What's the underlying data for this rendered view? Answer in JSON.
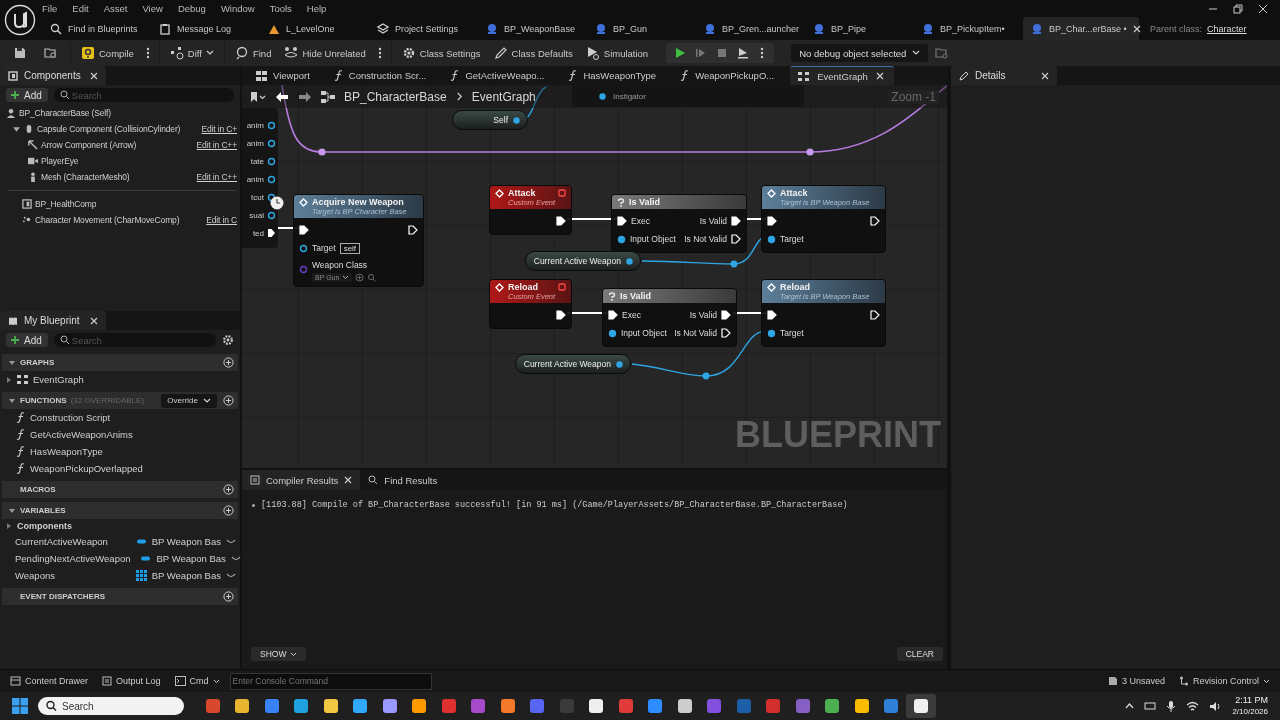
{
  "menu": [
    "File",
    "Edit",
    "Asset",
    "View",
    "Debug",
    "Window",
    "Tools",
    "Help"
  ],
  "asset_tabs": [
    {
      "label": "Find in Blueprints",
      "kind": "search",
      "selected": false
    },
    {
      "label": "Message Log",
      "kind": "log",
      "selected": false
    },
    {
      "label": "L_LevelOne",
      "kind": "level",
      "selected": false
    },
    {
      "label": "Project Settings",
      "kind": "settings",
      "selected": false
    },
    {
      "label": "BP_WeaponBase",
      "kind": "blueprint",
      "selected": false
    },
    {
      "label": "BP_Gun",
      "kind": "blueprint",
      "selected": false
    },
    {
      "label": "BP_Gren...auncher",
      "kind": "blueprint",
      "selected": false
    },
    {
      "label": "BP_Pipe",
      "kind": "blueprint",
      "selected": false
    },
    {
      "label": "BP_PickupItem•",
      "kind": "blueprint",
      "selected": false
    },
    {
      "label": "BP_Char...erBase •",
      "kind": "blueprint",
      "selected": true
    }
  ],
  "parent_class": {
    "label": "Parent class:",
    "value": "Character"
  },
  "toolbar": {
    "compile": "Compile",
    "diff": "Diff",
    "find": "Find",
    "hide_unrelated": "Hide Unrelated",
    "class_settings": "Class Settings",
    "class_defaults": "Class Defaults",
    "simulation": "Simulation",
    "debug_object": "No debug object selected"
  },
  "components": {
    "title": "Components",
    "add": "Add",
    "search_placeholder": "Search",
    "tree": [
      {
        "label": "BP_CharacterBase (Self)",
        "kind": "self",
        "children": [
          {
            "label": "Capsule Component (CollisionCylinder)",
            "kind": "capsule",
            "expanded": true,
            "edit_link": "Edit in C+",
            "children": [
              {
                "label": "Arrow Component (Arrow)",
                "kind": "arrow",
                "edit_link": "Edit in C++"
              },
              {
                "label": "PlayerEye",
                "kind": "camera"
              },
              {
                "label": "Mesh (CharacterMesh0)",
                "kind": "mesh",
                "edit_link": "Edit in C++"
              }
            ]
          }
        ]
      }
    ],
    "extra": [
      {
        "label": "BP_HealthComp",
        "kind": "actor"
      },
      {
        "label": "Character Movement (CharMoveComp)",
        "kind": "movement",
        "edit_link": "Edit in C"
      }
    ]
  },
  "my_blueprint": {
    "title": "My Blueprint",
    "add": "Add",
    "search_placeholder": "Search",
    "sections": [
      {
        "title": "GRAPHS",
        "expanded": true,
        "items": [
          {
            "label": "EventGraph",
            "kind": "graph"
          }
        ]
      },
      {
        "title": "FUNCTIONS",
        "note": "(32 OVERRIDABLE)",
        "override": "Override",
        "expanded": true,
        "items": [
          {
            "label": "Construction Script",
            "kind": "function"
          },
          {
            "label": "GetActiveWeaponAnims",
            "kind": "function"
          },
          {
            "label": "HasWeaponType",
            "kind": "function"
          },
          {
            "label": "WeaponPickupOverlapped",
            "kind": "function"
          }
        ]
      },
      {
        "title": "MACROS"
      },
      {
        "title": "VARIABLES",
        "expanded": true,
        "categories": [
          {
            "label": "Components",
            "expanded": false
          }
        ],
        "variables": [
          {
            "name": "CurrentActiveWeapon",
            "type": "BP Weapon Bas",
            "kind": "single"
          },
          {
            "name": "PendingNextActiveWeapon",
            "type": "BP Weapon Bas",
            "kind": "single"
          },
          {
            "name": "Weapons",
            "type": "BP Weapon Bas",
            "kind": "array"
          }
        ]
      },
      {
        "title": "EVENT DISPATCHERS"
      }
    ]
  },
  "graph_tabs": [
    {
      "label": "Viewport",
      "kind": "viewport",
      "selected": false
    },
    {
      "label": "Construction Scr...",
      "kind": "function",
      "selected": false
    },
    {
      "label": "GetActiveWeapo...",
      "kind": "function",
      "selected": false
    },
    {
      "label": "HasWeaponType",
      "kind": "function",
      "selected": false
    },
    {
      "label": "WeaponPickupO...",
      "kind": "function",
      "selected": false
    },
    {
      "label": "EventGraph",
      "kind": "graph",
      "selected": true
    }
  ],
  "graph": {
    "breadcrumb": [
      "BP_CharacterBase",
      "EventGraph"
    ],
    "zoom": "Zoom -1",
    "watermark": "BLUEPRINT",
    "top_node_pin": "Instigator",
    "cut_node_pins": [
      {
        "label": "anim",
        "kind": "data"
      },
      {
        "label": "anim",
        "kind": "data"
      },
      {
        "label": "tate",
        "kind": "data"
      },
      {
        "label": "anim",
        "kind": "data"
      },
      {
        "label": "tcut",
        "kind": "data"
      },
      {
        "label": "sual",
        "kind": "data"
      },
      {
        "label": "ted",
        "kind": "exec"
      }
    ],
    "nodes": [
      {
        "kind": "getter",
        "title": "Self"
      },
      {
        "kind": "function",
        "title": "Acquire New Weapon",
        "subtitle": "Target is BP Character Base",
        "rows": [
          {
            "left": {
              "kind": "exec",
              "linked": true
            },
            "right": {
              "kind": "exec",
              "linked": false
            }
          },
          {
            "left": {
              "label": "Target",
              "kind": "data",
              "linked": false,
              "value": "self"
            }
          },
          {
            "left": {
              "label": "Weapon Class",
              "kind": "class",
              "linked": false,
              "dropdown": "BP Gun"
            }
          }
        ]
      },
      {
        "kind": "event",
        "title": "Attack",
        "subtitle": "Custom Event",
        "rows": [
          {
            "right": {
              "kind": "exec",
              "linked": true
            }
          }
        ]
      },
      {
        "kind": "macro",
        "title": "Is Valid",
        "rows": [
          {
            "left": {
              "label": "Exec",
              "kind": "exec",
              "linked": true
            },
            "right": {
              "label": "Is Valid",
              "kind": "exec",
              "linked": true
            }
          },
          {
            "left": {
              "label": "Input Object",
              "kind": "data",
              "linked": true
            },
            "right": {
              "label": "Is Not Valid",
              "kind": "exec",
              "linked": false
            }
          }
        ]
      },
      {
        "kind": "function",
        "title": "Attack",
        "subtitle": "Target is BP Weapon Base",
        "rows": [
          {
            "left": {
              "kind": "exec",
              "linked": true
            },
            "right": {
              "kind": "exec",
              "linked": false
            }
          },
          {
            "left": {
              "label": "Target",
              "kind": "data",
              "linked": true
            }
          }
        ]
      },
      {
        "kind": "getter",
        "title": "Current Active Weapon"
      },
      {
        "kind": "event",
        "title": "Reload",
        "subtitle": "Custom Event",
        "rows": [
          {
            "right": {
              "kind": "exec",
              "linked": true
            }
          }
        ]
      },
      {
        "kind": "macro",
        "title": "Is Valid",
        "rows": [
          {
            "left": {
              "label": "Exec",
              "kind": "exec",
              "linked": true
            },
            "right": {
              "label": "Is Valid",
              "kind": "exec",
              "linked": true
            }
          },
          {
            "left": {
              "label": "Input Object",
              "kind": "data",
              "linked": true
            },
            "right": {
              "label": "Is Not Valid",
              "kind": "exec",
              "linked": false
            }
          }
        ]
      },
      {
        "kind": "function",
        "title": "Reload",
        "subtitle": "Target is BP Weapon Base",
        "rows": [
          {
            "left": {
              "kind": "exec",
              "linked": true
            },
            "right": {
              "kind": "exec",
              "linked": false
            }
          },
          {
            "left": {
              "label": "Target",
              "kind": "data",
              "linked": true
            }
          }
        ]
      },
      {
        "kind": "getter",
        "title": "Current Active Weapon"
      }
    ]
  },
  "output": {
    "tabs": [
      {
        "label": "Compiler Results",
        "selected": true
      },
      {
        "label": "Find Results",
        "selected": false
      }
    ],
    "lines": [
      "[1103.88] Compile of BP_CharacterBase successful! [in 91 ms] (/Game/PlayerAssets/BP_CharacterBase.BP_CharacterBase)"
    ],
    "show": "SHOW",
    "clear": "CLEAR"
  },
  "details": {
    "title": "Details"
  },
  "status_bar": {
    "content_drawer": "Content Drawer",
    "output_log": "Output Log",
    "cmd": "Cmd",
    "console_placeholder": "Enter Console Command",
    "unsaved": "3 Unsaved",
    "revision_control": "Revision Control"
  },
  "taskbar": {
    "search_placeholder": "Search",
    "time": "2:11 PM",
    "date": "2/10/2026",
    "apps": [
      {
        "color": "#d8482c",
        "selected": false
      },
      {
        "color": "#e9b52f",
        "selected": false
      },
      {
        "color": "#3b82f6",
        "selected": false
      },
      {
        "color": "#1fa1e0",
        "selected": false
      },
      {
        "color": "#f2c744",
        "selected": false
      },
      {
        "color": "#31a8ff",
        "selected": false
      },
      {
        "color": "#9999ff",
        "selected": false
      },
      {
        "color": "#ff9a00",
        "selected": false
      },
      {
        "color": "#e03030",
        "selected": false
      },
      {
        "color": "#a64ac9",
        "selected": false
      },
      {
        "color": "#f5792a",
        "selected": false
      },
      {
        "color": "#5865f2",
        "selected": false
      },
      {
        "color": "#3a3a3a",
        "selected": false
      },
      {
        "color": "#eeeeee",
        "selected": false
      },
      {
        "color": "#e03a3a",
        "selected": false
      },
      {
        "color": "#2d8cff",
        "selected": false
      },
      {
        "color": "#cccccc",
        "selected": false
      },
      {
        "color": "#8250df",
        "selected": false
      },
      {
        "color": "#1b5fa8",
        "selected": false
      },
      {
        "color": "#d32f2f",
        "selected": false
      },
      {
        "color": "#865fc5",
        "selected": false
      },
      {
        "color": "#4caf50",
        "selected": false
      },
      {
        "color": "#fbbc05",
        "selected": false
      },
      {
        "color": "#2f7fd8",
        "selected": false
      },
      {
        "color": "#f0f0f0",
        "selected": true
      }
    ]
  }
}
